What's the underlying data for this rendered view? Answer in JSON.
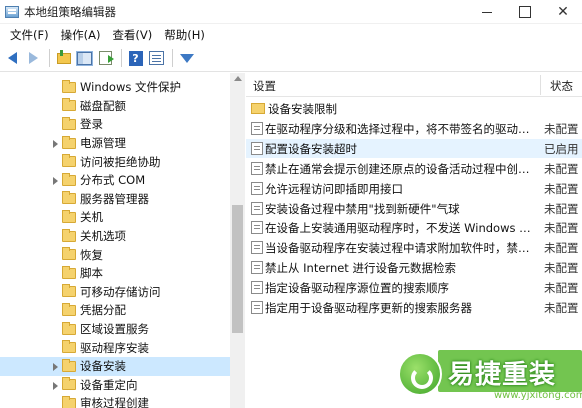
{
  "window": {
    "title": "本地组策略编辑器"
  },
  "menu": [
    "文件(F)",
    "操作(A)",
    "查看(V)",
    "帮助(H)"
  ],
  "toolbar": {
    "buttons": [
      "back-arrow-icon",
      "forward-arrow-icon",
      "up-folder-icon",
      "show-hide-tree-icon",
      "export-list-icon",
      "help-icon",
      "properties-icon",
      "filter-icon"
    ]
  },
  "tree": {
    "items": [
      {
        "label": "Windows 文件保护",
        "expandable": false,
        "selected": false
      },
      {
        "label": "磁盘配额",
        "expandable": false,
        "selected": false
      },
      {
        "label": "登录",
        "expandable": false,
        "selected": false
      },
      {
        "label": "电源管理",
        "expandable": true,
        "selected": false
      },
      {
        "label": "访问被拒绝协助",
        "expandable": false,
        "selected": false
      },
      {
        "label": "分布式 COM",
        "expandable": true,
        "selected": false
      },
      {
        "label": "服务器管理器",
        "expandable": false,
        "selected": false
      },
      {
        "label": "关机",
        "expandable": false,
        "selected": false
      },
      {
        "label": "关机选项",
        "expandable": false,
        "selected": false
      },
      {
        "label": "恢复",
        "expandable": false,
        "selected": false
      },
      {
        "label": "脚本",
        "expandable": false,
        "selected": false
      },
      {
        "label": "可移动存储访问",
        "expandable": false,
        "selected": false
      },
      {
        "label": "凭据分配",
        "expandable": false,
        "selected": false
      },
      {
        "label": "区域设置服务",
        "expandable": false,
        "selected": false
      },
      {
        "label": "驱动程序安装",
        "expandable": false,
        "selected": false
      },
      {
        "label": "设备安装",
        "expandable": true,
        "selected": true
      },
      {
        "label": "设备重定向",
        "expandable": true,
        "selected": false
      },
      {
        "label": "审核过程创建",
        "expandable": false,
        "selected": false
      }
    ]
  },
  "list": {
    "col_setting": "设置",
    "col_state": "状态",
    "rows": [
      {
        "type": "folder",
        "text": "设备安装限制",
        "state": ""
      },
      {
        "type": "policy",
        "text": "在驱动程序分级和选择过程中，将不带签名的驱动程序视为与已数字签名的驱动程序等同",
        "state": "未配置"
      },
      {
        "type": "policy",
        "text": "配置设备安装超时",
        "state": "已启用"
      },
      {
        "type": "policy",
        "text": "禁止在通常会提示创建还原点的设备活动过程中创建系统还原点",
        "state": "未配置"
      },
      {
        "type": "policy",
        "text": "允许远程访问即插即用接口",
        "state": "未配置"
      },
      {
        "type": "policy",
        "text": "安装设备过程中禁用\"找到新硬件\"气球",
        "state": "未配置"
      },
      {
        "type": "policy",
        "text": "在设备上安装通用驱动程序时，不发送 Windows 错误报告",
        "state": "未配置"
      },
      {
        "type": "policy",
        "text": "当设备驱动程序在安装过程中请求附加软件时，禁止 Windows 检索",
        "state": "未配置"
      },
      {
        "type": "policy",
        "text": "禁止从 Internet 进行设备元数据检索",
        "state": "未配置"
      },
      {
        "type": "policy",
        "text": "指定设备驱动程序源位置的搜索顺序",
        "state": "未配置"
      },
      {
        "type": "policy",
        "text": "指定用于设备驱动程序更新的搜索服务器",
        "state": "未配置"
      }
    ]
  },
  "watermark": {
    "brand": "易捷重装",
    "url": "www.yjxitong.com"
  }
}
